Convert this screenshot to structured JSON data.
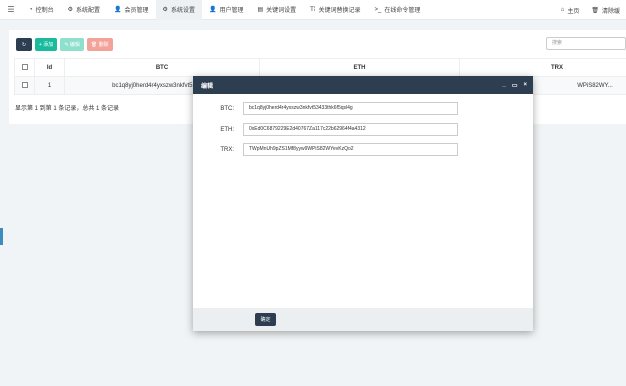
{
  "topnav": {
    "menu_icon": "menu-icon",
    "tabs": [
      {
        "icon": "dashboard-icon",
        "label": "控制台"
      },
      {
        "icon": "gear-icon",
        "label": "系统配置"
      },
      {
        "icon": "user-icon",
        "label": "会员管理"
      },
      {
        "icon": "gear-icon",
        "label": "系统设置"
      },
      {
        "icon": "user-icon",
        "label": "用户管理"
      },
      {
        "icon": "document-icon",
        "label": "关键词设置"
      },
      {
        "icon": "text-icon",
        "label": "关键词替换记录"
      },
      {
        "icon": "terminal-icon",
        "label": "在线命令管理"
      }
    ],
    "active_tab": "系统设置",
    "right": [
      {
        "icon": "home-icon",
        "label": "主页"
      },
      {
        "icon": "trash-icon",
        "label": "清除缓"
      }
    ]
  },
  "toolbar": {
    "refresh_icon": "refresh-icon",
    "add_label": "+ 添加",
    "edit_label": "✎ 编辑",
    "delete_label": "🗑 删除",
    "search_placeholder": "搜索"
  },
  "table": {
    "columns": [
      "",
      "Id",
      "BTC",
      "ETH",
      "TRX"
    ],
    "rows": [
      {
        "id": "1",
        "btc": "bc1q8yj0herd4r4yxszw3nkfvt53433th...",
        "eth": "",
        "trx": "WPiS82WY..."
      }
    ]
  },
  "pager": {
    "text": "显示第 1 到第 1 条记录，总共 1 条记录"
  },
  "modal": {
    "title": "编辑",
    "controls": [
      "_",
      "▭",
      "×"
    ],
    "fields": [
      {
        "label": "BTC:",
        "value": "bc1q8yj0herd4r4yxszw3nkfvt53433thk6f5qsl4g"
      },
      {
        "label": "ETH:",
        "value": "0xEd0C6879229E2d40767Za117c22b62964f4a4312"
      },
      {
        "label": "TRX:",
        "value": "TWpMnUh9pZS1Mf8yyw9WPiS82WYevKzQo2"
      }
    ],
    "ok_label": "确定"
  },
  "colors": {
    "primary": "#2c3e50",
    "success": "#18bc9c",
    "danger": "#f3a29a"
  }
}
